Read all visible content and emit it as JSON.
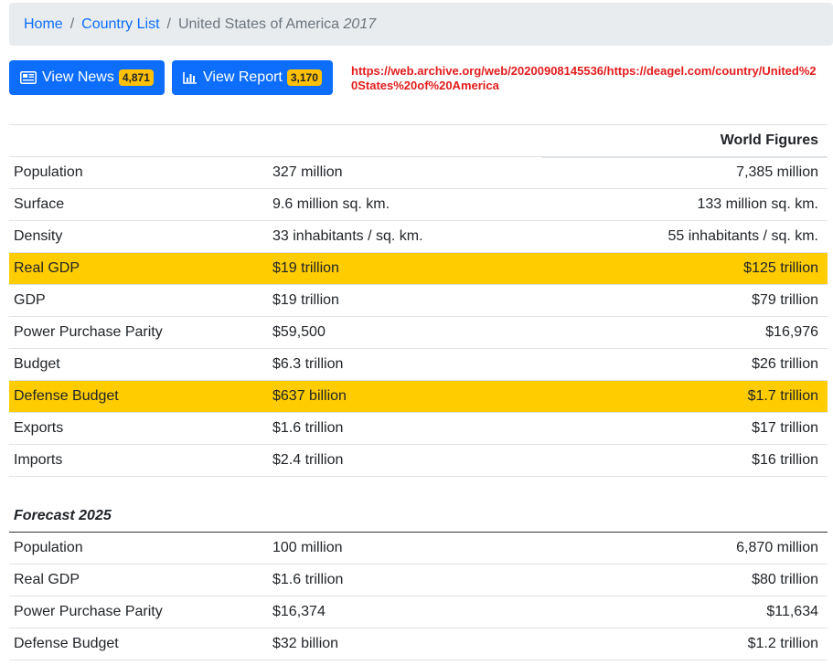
{
  "breadcrumb": {
    "home": "Home",
    "country_list": "Country List",
    "current": "United States of America",
    "year": "2017"
  },
  "buttons": {
    "news_label": "View News",
    "news_count": "4,871",
    "report_label": "View Report",
    "report_count": "3,170"
  },
  "archive_url": "https://web.archive.org/web/20200908145536/https://deagel.com/country/United%20States%20of%20America",
  "main_table": {
    "header": "World Figures",
    "rows": [
      {
        "label": "Population",
        "country": "327 million",
        "world": "7,385 million"
      },
      {
        "label": "Surface",
        "country": "9.6 million sq. km.",
        "world": "133 million sq. km."
      },
      {
        "label": "Density",
        "country": "33 inhabitants / sq. km.",
        "world": "55 inhabitants / sq. km."
      },
      {
        "label": "Real GDP",
        "country": "$19 trillion",
        "world": "$125 trillion"
      },
      {
        "label": "GDP",
        "country": "$19 trillion",
        "world": "$79 trillion"
      },
      {
        "label": "Power Purchase Parity",
        "country": "$59,500",
        "world": "$16,976"
      },
      {
        "label": "Budget",
        "country": "$6.3 trillion",
        "world": "$26 trillion"
      },
      {
        "label": "Defense Budget",
        "country": "$637 billion",
        "world": "$1.7 trillion"
      },
      {
        "label": "Exports",
        "country": "$1.6 trillion",
        "world": "$17 trillion"
      },
      {
        "label": "Imports",
        "country": "$2.4 trillion",
        "world": "$16 trillion"
      }
    ]
  },
  "forecast_table": {
    "header": "Forecast 2025",
    "rows": [
      {
        "label": "Population",
        "country": "100 million",
        "world": "6,870 million"
      },
      {
        "label": "Real GDP",
        "country": "$1.6 trillion",
        "world": "$80 trillion"
      },
      {
        "label": "Power Purchase Parity",
        "country": "$16,374",
        "world": "$11,634"
      },
      {
        "label": "Defense Budget",
        "country": "$32 billion",
        "world": "$1.2 trillion"
      }
    ]
  },
  "colors": {
    "highlight": "#ffcc00",
    "primary": "#0d6efd",
    "badge": "#ffc107",
    "url_red": "#e31c1c"
  },
  "icons": {
    "news": "newspaper-icon",
    "report": "bar-chart-icon"
  }
}
